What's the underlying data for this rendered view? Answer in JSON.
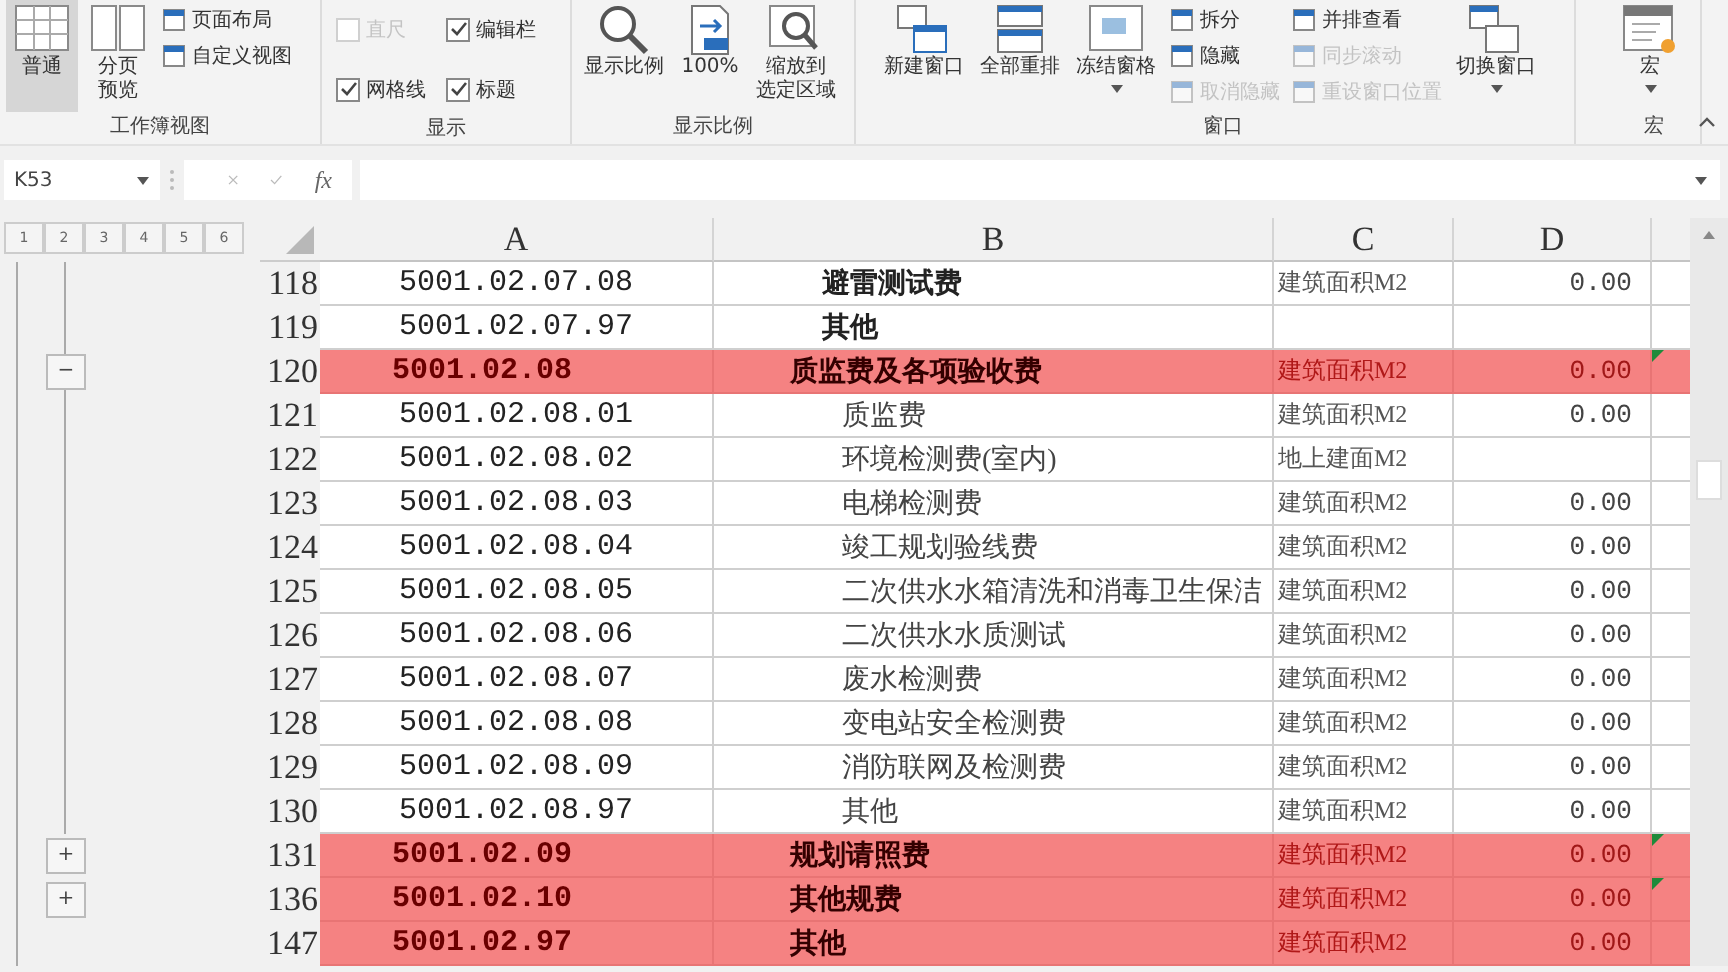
{
  "ribbon": {
    "groups": [
      {
        "label": "工作簿视图",
        "items": [
          {
            "kind": "large",
            "label": "普通",
            "selected": true
          },
          {
            "kind": "large",
            "lines": [
              "分页",
              "预览"
            ],
            "selected": false
          },
          {
            "kind": "stack",
            "items": [
              {
                "kind": "small",
                "label": "页面布局"
              },
              {
                "kind": "small",
                "label": "自定义视图"
              }
            ]
          }
        ]
      },
      {
        "label": "显示",
        "items": [
          {
            "kind": "stack",
            "items": [
              {
                "kind": "check",
                "label": "直尺",
                "checked": false,
                "disabled": true
              },
              {
                "kind": "check",
                "label": "网格线",
                "checked": true,
                "disabled": false
              }
            ]
          },
          {
            "kind": "stack",
            "items": [
              {
                "kind": "check",
                "label": "编辑栏",
                "checked": true,
                "disabled": false
              },
              {
                "kind": "check",
                "label": "标题",
                "checked": true,
                "disabled": false
              }
            ]
          }
        ]
      },
      {
        "label": "显示比例",
        "items": [
          {
            "kind": "large",
            "label": "显示比例"
          },
          {
            "kind": "large",
            "label": "100%"
          },
          {
            "kind": "large",
            "lines": [
              "缩放到",
              "选定区域"
            ]
          }
        ]
      },
      {
        "label": "窗口",
        "items": [
          {
            "kind": "large",
            "label": "新建窗口"
          },
          {
            "kind": "large",
            "label": "全部重排"
          },
          {
            "kind": "large",
            "label": "冻结窗格",
            "dropdown": true
          },
          {
            "kind": "stack",
            "items": [
              {
                "kind": "small",
                "label": "拆分",
                "disabled": false
              },
              {
                "kind": "small",
                "label": "隐藏",
                "disabled": false
              },
              {
                "kind": "small",
                "label": "取消隐藏",
                "disabled": true
              }
            ]
          },
          {
            "kind": "stack",
            "items": [
              {
                "kind": "small",
                "label": "并排查看",
                "disabled": false
              },
              {
                "kind": "small",
                "label": "同步滚动",
                "disabled": true
              },
              {
                "kind": "small",
                "label": "重设窗口位置",
                "disabled": true
              }
            ]
          },
          {
            "kind": "large",
            "label": "切换窗口",
            "dropdown": true
          }
        ]
      },
      {
        "label": "宏",
        "items": [
          {
            "kind": "large",
            "label": "宏",
            "dropdown": true
          }
        ]
      }
    ]
  },
  "formula_bar": {
    "name_box": "K53",
    "fx": "fx"
  },
  "outline_levels": [
    "1",
    "2",
    "3",
    "4",
    "5",
    "6"
  ],
  "sheet": {
    "columns": [
      "A",
      "B",
      "C",
      "D"
    ],
    "rows": [
      {
        "number": "118",
        "kind": "item",
        "a": "5001.02.07.08",
        "b": "避雷测试费",
        "c": "建筑面积M2",
        "d": "0.00"
      },
      {
        "number": "119",
        "kind": "item",
        "a": "5001.02.07.97",
        "b": "其他"
      },
      {
        "number": "120",
        "kind": "group",
        "outline": "−",
        "flag": true,
        "a": "5001.02.08",
        "b": "质监费及各项验收费",
        "c": "建筑面积M2",
        "d": "0.00"
      },
      {
        "number": "121",
        "kind": "sub",
        "a": "5001.02.08.01",
        "b": "质监费",
        "c": "建筑面积M2",
        "d": "0.00"
      },
      {
        "number": "122",
        "kind": "sub",
        "a": "5001.02.08.02",
        "b": "环境检测费(室内)",
        "c": "地上建面M2"
      },
      {
        "number": "123",
        "kind": "sub",
        "a": "5001.02.08.03",
        "b": "电梯检测费",
        "c": "建筑面积M2",
        "d": "0.00"
      },
      {
        "number": "124",
        "kind": "sub",
        "a": "5001.02.08.04",
        "b": "竣工规划验线费",
        "c": "建筑面积M2",
        "d": "0.00"
      },
      {
        "number": "125",
        "kind": "sub",
        "a": "5001.02.08.05",
        "b": "二次供水水箱清洗和消毒卫生保洁",
        "c": "建筑面积M2",
        "d": "0.00"
      },
      {
        "number": "126",
        "kind": "sub",
        "a": "5001.02.08.06",
        "b": "二次供水水质测试",
        "c": "建筑面积M2",
        "d": "0.00"
      },
      {
        "number": "127",
        "kind": "sub",
        "a": "5001.02.08.07",
        "b": "废水检测费",
        "c": "建筑面积M2",
        "d": "0.00"
      },
      {
        "number": "128",
        "kind": "sub",
        "a": "5001.02.08.08",
        "b": "变电站安全检测费",
        "c": "建筑面积M2",
        "d": "0.00"
      },
      {
        "number": "129",
        "kind": "sub",
        "a": "5001.02.08.09",
        "b": "消防联网及检测费",
        "c": "建筑面积M2",
        "d": "0.00"
      },
      {
        "number": "130",
        "kind": "sub",
        "a": "5001.02.08.97",
        "b": "其他",
        "c": "建筑面积M2",
        "d": "0.00"
      },
      {
        "number": "131",
        "kind": "group",
        "outline": "+",
        "flag": true,
        "a": "5001.02.09",
        "b": "规划请照费",
        "c": "建筑面积M2",
        "d": "0.00"
      },
      {
        "number": "136",
        "kind": "group",
        "outline": "+",
        "flag": true,
        "a": "5001.02.10",
        "b": "其他规费",
        "c": "建筑面积M2",
        "d": "0.00"
      },
      {
        "number": "147",
        "kind": "group",
        "flag": false,
        "a": "5001.02.97",
        "b": "其他",
        "c": "建筑面积M2",
        "d": "0.00"
      }
    ]
  }
}
